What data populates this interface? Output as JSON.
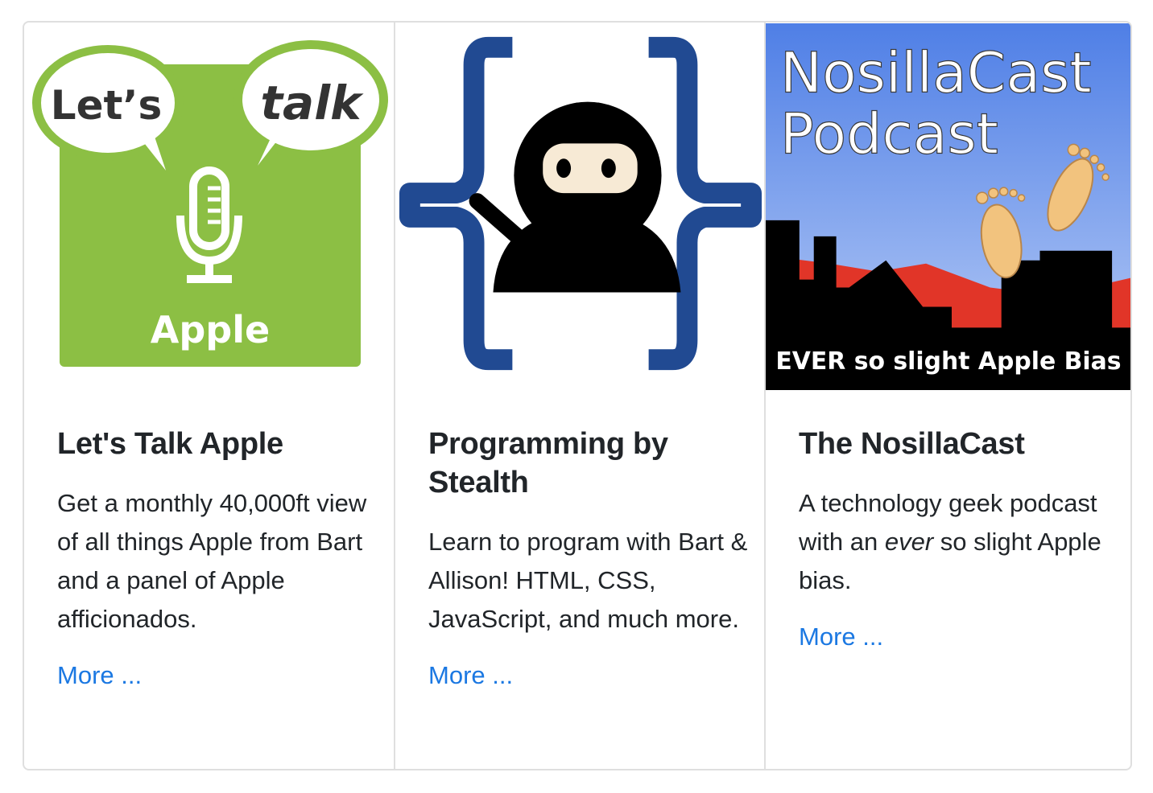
{
  "colors": {
    "link": "#1b78e2",
    "text": "#212529",
    "border": "#dfdfdf",
    "lta_green": "#8cbf44",
    "pbs_blue": "#214a92",
    "nc_sky_top": "#4f7fe6",
    "nc_red": "#e13528"
  },
  "cards": [
    {
      "image": {
        "bubble_left": "Let’s",
        "bubble_right": "talk",
        "label": "Apple",
        "icon": "microphone-icon"
      },
      "title": "Let's Talk Apple",
      "description": "Get a monthly 40,000ft view of all things Apple from Bart and a panel of Apple afficionados.",
      "link": "More ..."
    },
    {
      "image": {
        "icon": "ninja-in-braces-icon"
      },
      "title": "Programming by Stealth",
      "description": "Learn to program with Bart & Allison! HTML, CSS, JavaScript, and much more.",
      "link": "More ..."
    },
    {
      "image": {
        "line1": "NosillaCast",
        "line2": "Podcast",
        "tagline": "EVER so slight Apple Bias",
        "icon": "footprints-icon"
      },
      "title": "The NosillaCast",
      "description_before": "A technology geek podcast with an ",
      "description_em": "ever",
      "description_after": " so slight Apple bias.",
      "link": "More ..."
    }
  ]
}
